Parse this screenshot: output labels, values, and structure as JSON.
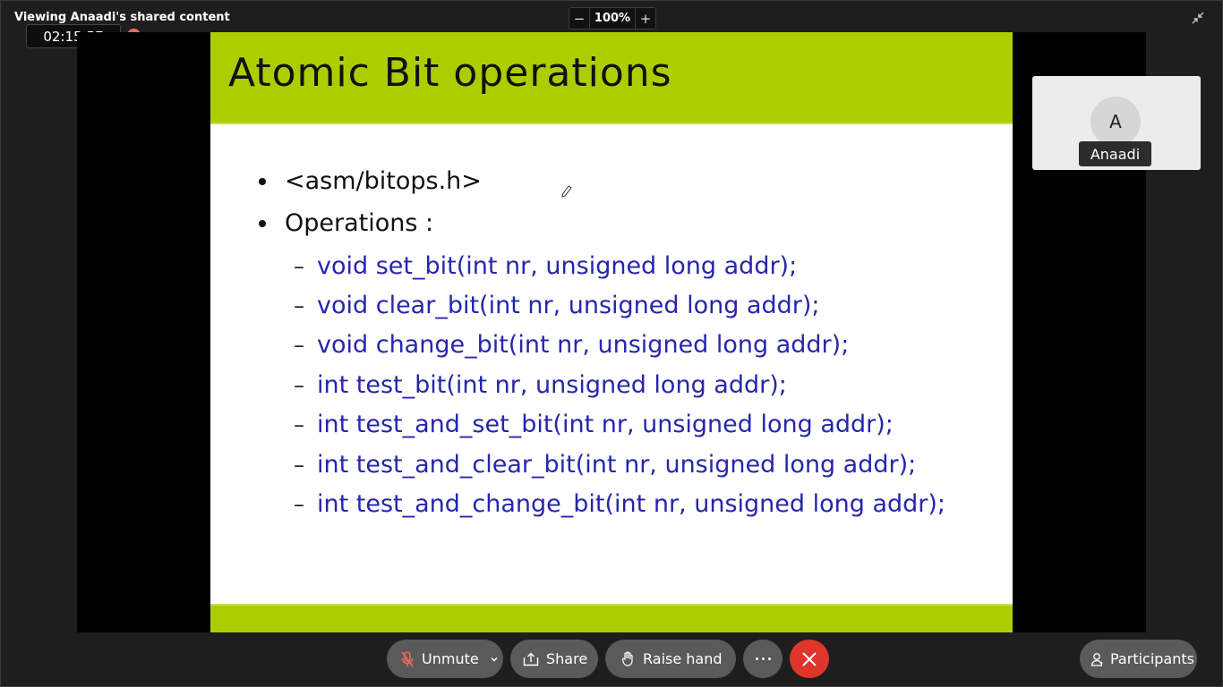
{
  "top_bar": {
    "viewing_label": "Viewing Anaadi's shared content",
    "timer": "02:15:57",
    "zoom_out": "−",
    "zoom_value": "100%",
    "zoom_in": "+"
  },
  "slide": {
    "title": "Atomic Bit operations",
    "bullets": [
      "<asm/bitops.h>",
      "Operations :"
    ],
    "sub_items": [
      "void set_bit(int nr, unsigned long addr);",
      "void clear_bit(int nr, unsigned long addr);",
      "void change_bit(int nr, unsigned long addr);",
      "int test_bit(int nr, unsigned long addr);",
      "int test_and_set_bit(int nr, unsigned long addr);",
      "int test_and_clear_bit(int nr, unsigned long addr);",
      "int test_and_change_bit(int nr, unsigned long addr);"
    ],
    "dash": "–",
    "colors": {
      "header_green": "#acce00",
      "code_blue": "#2626ad"
    }
  },
  "participant_tile": {
    "initial": "A",
    "name": "Anaadi"
  },
  "controls": {
    "unmute": "Unmute",
    "share": "Share",
    "raise_hand": "Raise hand",
    "participants": "Participants",
    "leave_color": "#e0352b"
  }
}
